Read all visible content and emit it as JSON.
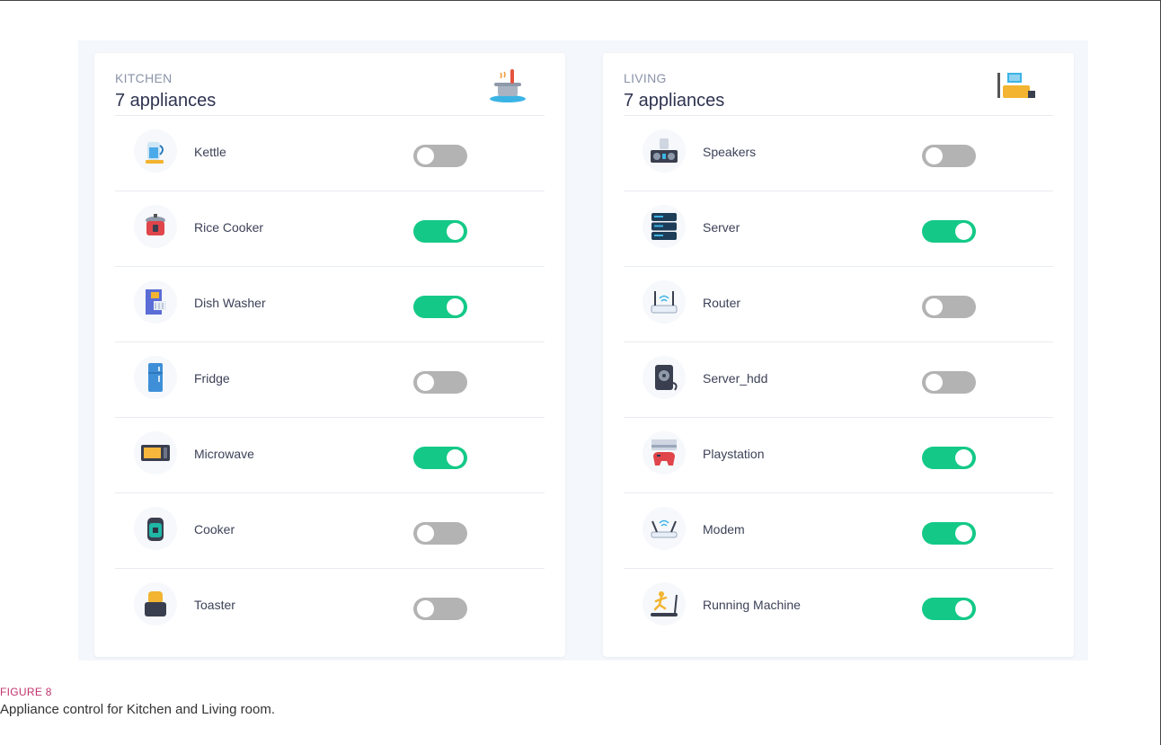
{
  "caption": {
    "figure_label": "FIGURE 8",
    "text": "Appliance control for Kitchen and Living room."
  },
  "rooms": [
    {
      "name": "KITCHEN",
      "count_label": "7 appliances",
      "icon": "cooking-pot-icon",
      "appliances": [
        {
          "label": "Kettle",
          "icon": "kettle-icon",
          "on": false
        },
        {
          "label": "Rice Cooker",
          "icon": "rice-cooker-icon",
          "on": true
        },
        {
          "label": "Dish Washer",
          "icon": "dish-washer-icon",
          "on": true
        },
        {
          "label": "Fridge",
          "icon": "fridge-icon",
          "on": false
        },
        {
          "label": "Microwave",
          "icon": "microwave-icon",
          "on": true
        },
        {
          "label": "Cooker",
          "icon": "cooker-icon",
          "on": false
        },
        {
          "label": "Toaster",
          "icon": "toaster-icon",
          "on": false
        }
      ]
    },
    {
      "name": "LIVING",
      "count_label": "7 appliances",
      "icon": "living-room-icon",
      "appliances": [
        {
          "label": "Speakers",
          "icon": "speakers-icon",
          "on": false
        },
        {
          "label": "Server",
          "icon": "server-icon",
          "on": true
        },
        {
          "label": "Router",
          "icon": "router-icon",
          "on": false
        },
        {
          "label": "Server_hdd",
          "icon": "hdd-icon",
          "on": false
        },
        {
          "label": "Playstation",
          "icon": "playstation-icon",
          "on": true
        },
        {
          "label": "Modem",
          "icon": "modem-icon",
          "on": true
        },
        {
          "label": "Running Machine",
          "icon": "treadmill-icon",
          "on": true
        }
      ]
    }
  ],
  "colors": {
    "toggle_on": "#14c987",
    "toggle_off": "#b3b3b3",
    "caption_label": "#c0336a"
  }
}
